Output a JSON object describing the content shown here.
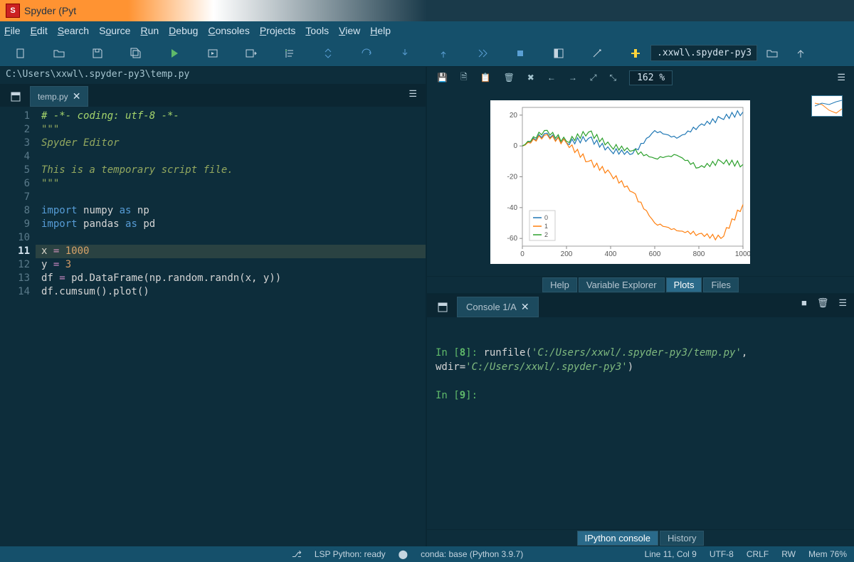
{
  "title": "Spyder (Pyt",
  "menu": [
    "File",
    "Edit",
    "Search",
    "Source",
    "Run",
    "Debug",
    "Consoles",
    "Projects",
    "Tools",
    "View",
    "Help"
  ],
  "menu_underlines": [
    "F",
    "E",
    "S",
    "o",
    "R",
    "D",
    "C",
    "P",
    "T",
    "V",
    "H"
  ],
  "toolbar_path_value": ".xxwl\\.spyder-py3",
  "filepath": "C:\\Users\\xxwl\\.spyder-py3\\temp.py",
  "editor_tab": "temp.py",
  "code_lines": [
    {
      "n": 1,
      "html": "<span class='c-comment'># -*- coding: utf-8 -*-</span>"
    },
    {
      "n": 2,
      "html": "<span class='c-docstring'>\"\"\"</span>"
    },
    {
      "n": 3,
      "html": "<span class='c-docstring'>Spyder Editor</span>"
    },
    {
      "n": 4,
      "html": ""
    },
    {
      "n": 5,
      "html": "<span class='c-docstring'>This is a temporary script file.</span>"
    },
    {
      "n": 6,
      "html": "<span class='c-docstring'>\"\"\"</span>"
    },
    {
      "n": 7,
      "html": ""
    },
    {
      "n": 8,
      "html": "<span class='c-keyword'>import</span> <span class='c-name'>numpy</span> <span class='c-keyword'>as</span> <span class='c-name'>np</span>"
    },
    {
      "n": 9,
      "html": "<span class='c-keyword'>import</span> <span class='c-name'>pandas</span> <span class='c-keyword'>as</span> <span class='c-name'>pd</span>"
    },
    {
      "n": 10,
      "html": ""
    },
    {
      "n": 11,
      "html": "<span class='c-name'>x</span> <span class='c-op'>=</span> <span class='c-number'>1000</span>",
      "current": true
    },
    {
      "n": 12,
      "html": "<span class='c-name'>y</span> <span class='c-op'>=</span> <span class='c-number'>3</span>"
    },
    {
      "n": 13,
      "html": "<span class='c-name'>df</span> <span class='c-op'>=</span> <span class='c-func'>pd.DataFrame(np.random.randn(x, y))</span>"
    },
    {
      "n": 14,
      "html": "<span class='c-func'>df.cumsum().plot()</span>"
    }
  ],
  "plot_zoom": "162 %",
  "pane_tabs": [
    "Help",
    "Variable Explorer",
    "Plots",
    "Files"
  ],
  "pane_tab_active": 2,
  "console_tab": "Console 1/A",
  "console_lines": [
    {
      "type": "in",
      "n": 8,
      "cmd": "runfile(",
      "args": "'C:/Users/xxwl/.spyder-py3/temp.py'",
      "mid": ", wdir=",
      "args2": "'C:/Users/xxwl/.spyder-py3'",
      "end": ")"
    },
    {
      "type": "in",
      "n": 9,
      "cmd": "",
      "args": "",
      "mid": "",
      "args2": "",
      "end": ""
    }
  ],
  "console_pane_tabs": [
    "IPython console",
    "History"
  ],
  "console_pane_active": 0,
  "status": {
    "lsp": "LSP Python: ready",
    "conda": "conda: base (Python 3.9.7)",
    "pos": "Line 11, Col 9",
    "enc": "UTF-8",
    "eol": "CRLF",
    "rw": "RW",
    "mem": "Mem 76%"
  },
  "chart_data": {
    "type": "line",
    "title": "",
    "xlabel": "",
    "ylabel": "",
    "xlim": [
      0,
      1000
    ],
    "ylim": [
      -65,
      25
    ],
    "xticks": [
      0,
      200,
      400,
      600,
      800,
      1000
    ],
    "yticks": [
      -60,
      -40,
      -20,
      0,
      20
    ],
    "series": [
      {
        "name": "0",
        "color": "#1f77b4",
        "x": [
          0,
          100,
          200,
          300,
          400,
          500,
          600,
          700,
          800,
          900,
          1000
        ],
        "y": [
          0,
          8,
          2,
          5,
          -3,
          -5,
          10,
          5,
          13,
          18,
          22
        ]
      },
      {
        "name": "1",
        "color": "#ff7f0e",
        "x": [
          0,
          100,
          200,
          300,
          400,
          500,
          600,
          700,
          800,
          900,
          1000
        ],
        "y": [
          0,
          7,
          2,
          -10,
          -18,
          -30,
          -50,
          -55,
          -57,
          -60,
          -38
        ]
      },
      {
        "name": "2",
        "color": "#2ca02c",
        "x": [
          0,
          100,
          200,
          300,
          400,
          500,
          600,
          700,
          800,
          900,
          1000
        ],
        "y": [
          0,
          10,
          3,
          9,
          0,
          -3,
          -8,
          -6,
          -14,
          -10,
          -12
        ]
      }
    ],
    "legend": [
      "0",
      "1",
      "2"
    ]
  }
}
